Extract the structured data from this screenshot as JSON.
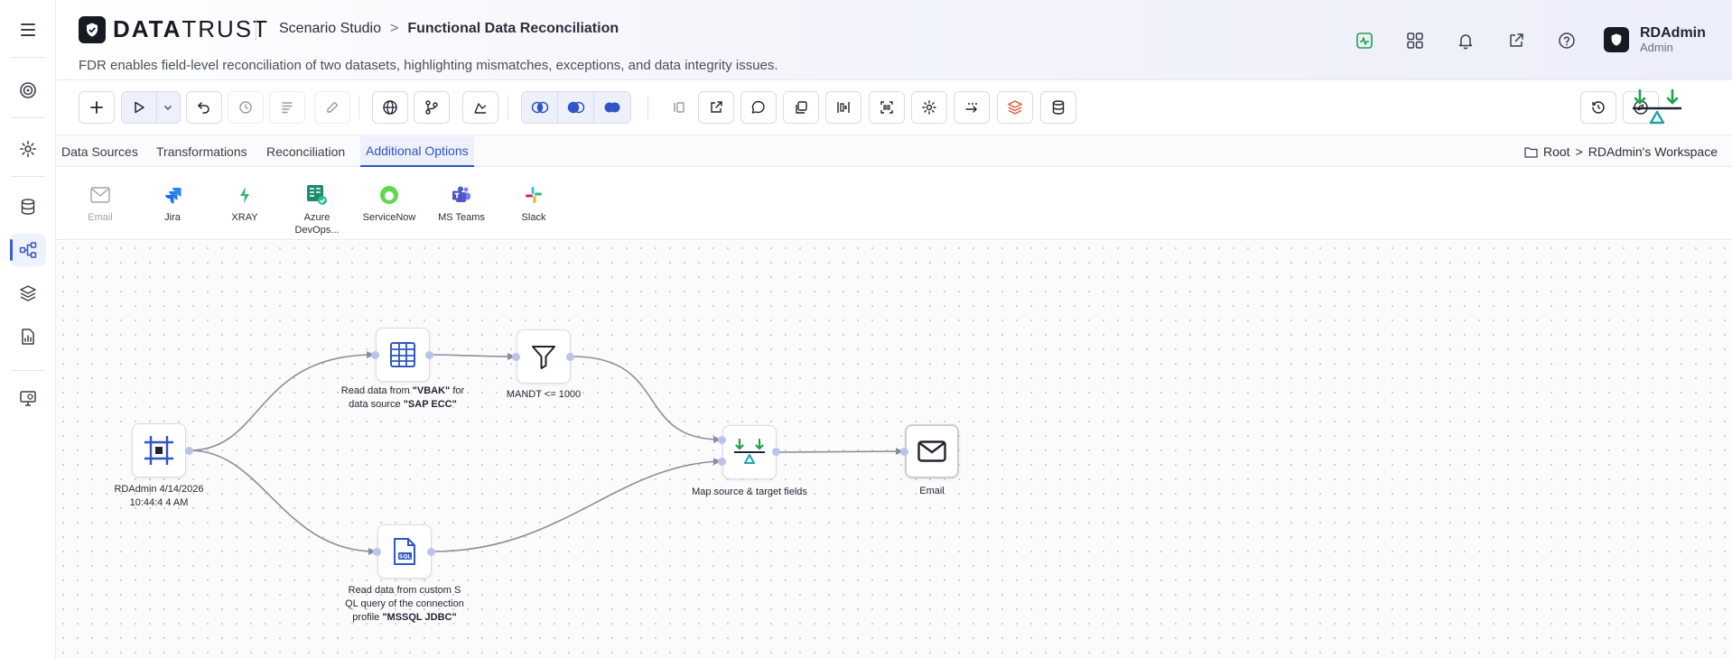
{
  "header": {
    "brand_bold": "DATA",
    "brand_thin": "TRUST",
    "breadcrumb_parent": "Scenario Studio",
    "breadcrumb_separator": ">",
    "breadcrumb_current": "Functional Data Reconciliation",
    "subtitle": "FDR enables field-level reconciliation of two datasets, highlighting mismatches, exceptions, and data integrity issues.",
    "icons": [
      "activity-icon",
      "apps-grid-icon",
      "bell-icon",
      "external-link-icon",
      "help-icon"
    ],
    "user": {
      "name": "RDAdmin",
      "role": "Admin"
    }
  },
  "rail": {
    "items": [
      "target-icon",
      "settings-icon",
      "database-icon",
      "workflow-icon",
      "layers-icon",
      "report-icon",
      "monitor-icon"
    ],
    "active": "workflow-icon"
  },
  "tabs": [
    {
      "label": "Data Sources"
    },
    {
      "label": "Transformations"
    },
    {
      "label": "Reconciliation"
    },
    {
      "label": "Additional Options"
    }
  ],
  "active_tab": "Additional Options",
  "workspace": {
    "root": "Root",
    "separator": ">",
    "name": "RDAdmin's Workspace"
  },
  "integrations": [
    {
      "label": "Email"
    },
    {
      "label": "Jira"
    },
    {
      "label": "XRAY"
    },
    {
      "label": "Azure DevOps..."
    },
    {
      "label": "ServiceNow"
    },
    {
      "label": "MS Teams"
    },
    {
      "label": "Slack"
    }
  ],
  "nodes": {
    "start": {
      "label": "RDAdmin 4/14/2026 10:44:4 4 AM"
    },
    "sap": {
      "label_pre": "Read data from ",
      "table": "\"VBAK\"",
      "label_mid": " for data source ",
      "source": "\"SAP ECC\""
    },
    "filter": {
      "label": "MANDT <= 1000"
    },
    "sql": {
      "label_pre": "Read data from custom S QL query of the connection profile ",
      "profile": "\"MSSQL JDBC\""
    },
    "reconcile": {
      "label": "Map source & target fields"
    },
    "email": {
      "label": "Email"
    }
  },
  "colors": {
    "accent": "#2f55c7",
    "recon_green": "#22a04b",
    "recon_teal": "#1ea3a8",
    "port": "#b9c3ee"
  }
}
